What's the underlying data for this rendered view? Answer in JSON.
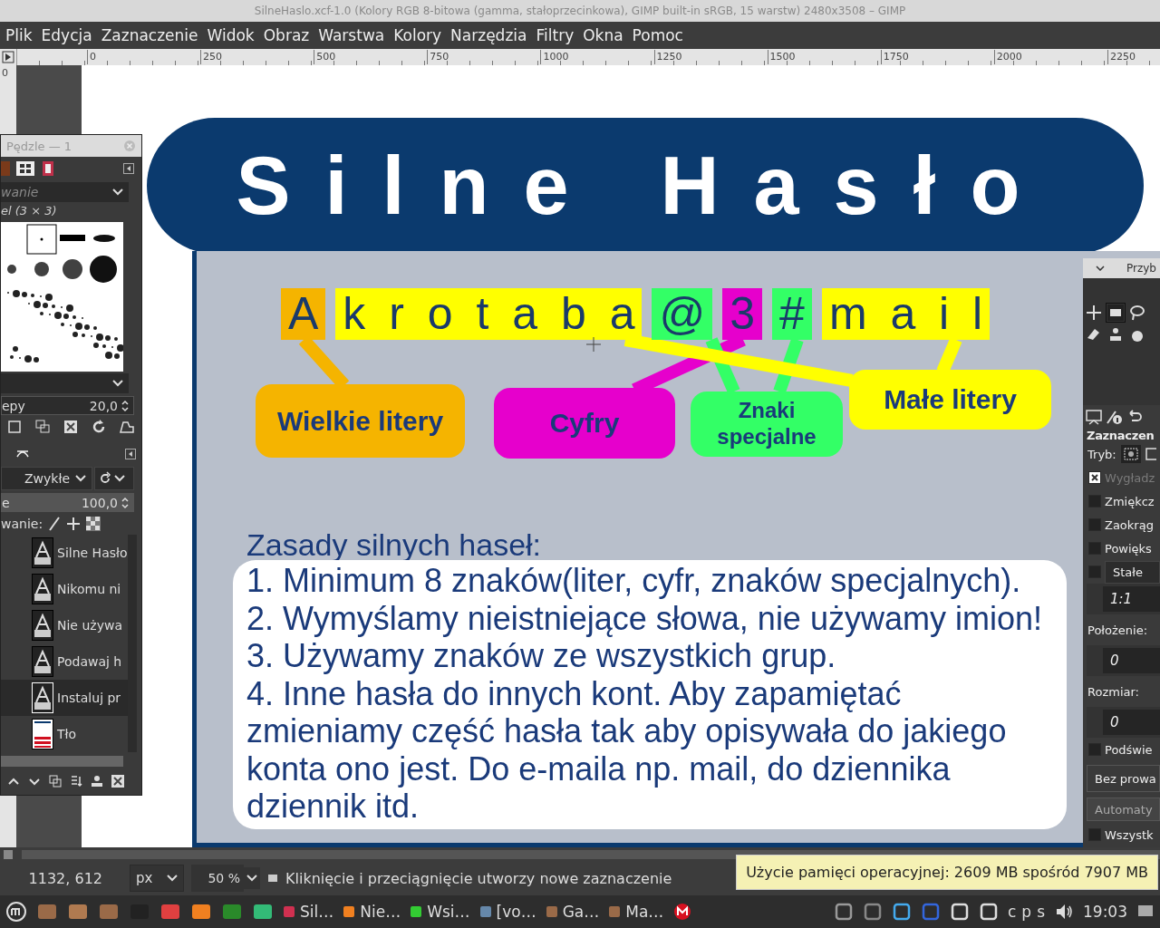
{
  "window": {
    "title": "SilneHaslo.xcf-1.0 (Kolory RGB 8-bitowa (gamma, stałoprzecinkowa), GIMP built-in sRGB, 15 warstw) 2480x3508 – GIMP"
  },
  "menu": [
    "Plik",
    "Edycja",
    "Zaznaczenie",
    "Widok",
    "Obraz",
    "Warstwa",
    "Kolory",
    "Narzędzia",
    "Filtry",
    "Okna",
    "Pomoc"
  ],
  "ruler": {
    "labels": [
      "0",
      "250",
      "500",
      "750",
      "1000",
      "1250",
      "1500",
      "1750",
      "2000",
      "2250"
    ],
    "side_label": "0"
  },
  "brushes_panel": {
    "title": "Pędzle — 1",
    "filter": "wanie",
    "brush_name": "el (3 × 3)",
    "spacing_label": "epy",
    "spacing_value": "20,0"
  },
  "layers_panel": {
    "mode": "Zwykłe",
    "opacity_label": "e",
    "opacity_value": "100,0",
    "lock_label": "wanie:",
    "layers": [
      {
        "name": "Silne Hasło",
        "kind": "text",
        "selected": false
      },
      {
        "name": "Nikomu ni",
        "kind": "text",
        "selected": false
      },
      {
        "name": "Nie używa",
        "kind": "text",
        "selected": false
      },
      {
        "name": "Podawaj h",
        "kind": "text",
        "selected": false
      },
      {
        "name": "Instaluj pr",
        "kind": "text",
        "selected": true
      },
      {
        "name": "Tło",
        "kind": "image",
        "selected": false
      }
    ]
  },
  "tool_panel": {
    "title": "Przyb",
    "tool_name": "Zaznaczen",
    "mode_label": "Tryb:",
    "items": [
      {
        "kind": "check",
        "label": "Wygładz",
        "checked": true,
        "disabled": true
      },
      {
        "kind": "check",
        "label": "Zmiękcz",
        "checked": false,
        "disabled": false
      },
      {
        "kind": "check",
        "label": "Zaokrąg",
        "checked": false,
        "disabled": false
      },
      {
        "kind": "check",
        "label": "Powięks",
        "checked": false,
        "disabled": false
      },
      {
        "kind": "check-dropdown",
        "label": "Stałe",
        "checked": false,
        "disabled": false
      },
      {
        "kind": "field",
        "value": "1:1"
      },
      {
        "kind": "label",
        "label": "Położenie:"
      },
      {
        "kind": "field",
        "value": "0"
      },
      {
        "kind": "label",
        "label": "Rozmiar:"
      },
      {
        "kind": "field",
        "value": "0"
      },
      {
        "kind": "check",
        "label": "Podświe",
        "checked": false,
        "disabled": false
      },
      {
        "kind": "dropdown",
        "label": "Bez prowa"
      },
      {
        "kind": "button",
        "label": "Automaty"
      },
      {
        "kind": "check",
        "label": "Wszystk",
        "checked": false,
        "disabled": false
      }
    ]
  },
  "poster": {
    "title": "Silne Hasło",
    "password_groups": [
      {
        "text": "A",
        "color": "#f5b400"
      },
      {
        "text": "k r o t a b a",
        "color": "#ffff00"
      },
      {
        "text": "@",
        "color": "#33ff66"
      },
      {
        "text": "3",
        "color": "#e600cc"
      },
      {
        "text": "#",
        "color": "#33ff66"
      },
      {
        "text": "m a i l",
        "color": "#ffff00"
      }
    ],
    "labels": [
      {
        "text": "Wielkie litery",
        "color": "#f5b400"
      },
      {
        "text": "Cyfry",
        "color": "#e600cc"
      },
      {
        "text": "Znaki specjalne",
        "color": "#33ff66"
      },
      {
        "text": "Małe litery",
        "color": "#ffff00"
      }
    ],
    "rules_heading": "Zasady silnych haseł:",
    "rules": [
      "1. Minimum 8 znaków(liter, cyfr, znaków specjalnych).",
      "2. Wymyślamy nieistniejące słowa, nie używamy imion!",
      "3. Używamy znaków ze wszystkich grup.",
      "4. Inne hasła do innych kont. Aby zapamiętać zmieniamy część hasła tak aby opisywała do jakiego konta ono jest. Do e-maila np. mail, do dziennika dziennik itd."
    ]
  },
  "status": {
    "coords": "1132, 612",
    "unit": "px",
    "zoom": "50 %",
    "message": "Kliknięcie i przeciągnięcie utworzy nowe zaznaczenie",
    "tooltip": "Użycie pamięci operacyjnej: 2609 MB spośród 7907 MB"
  },
  "taskbar": {
    "windows": [
      "Sil…",
      "Nie…",
      "Wsi…",
      "[vo…",
      "Ga…",
      "Ma…"
    ],
    "tray": [
      "c",
      "p",
      "s"
    ],
    "clock": "19:03"
  }
}
